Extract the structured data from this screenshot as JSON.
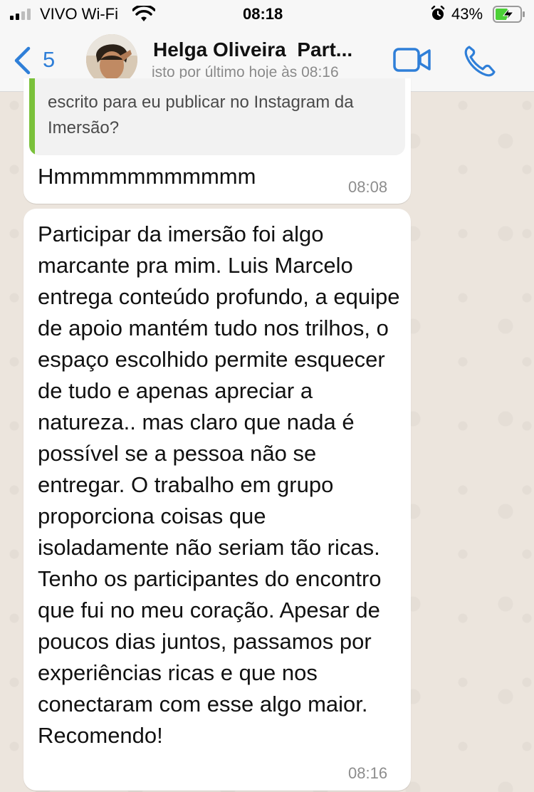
{
  "status_bar": {
    "carrier": "VIVO Wi-Fi",
    "time": "08:18",
    "battery_percent": "43%",
    "signal_bars_filled": 2,
    "signal_bars_total": 4,
    "battery_charging": true
  },
  "header": {
    "back_count": "5",
    "contact_name": "Helga Oliveira  Part...",
    "last_seen": "isto por último hoje às 08:16",
    "accent_color": "#2f7fd8"
  },
  "messages": [
    {
      "quote_text": "escrito para eu publicar no Instagram da Imersão?",
      "text": "Hmmmmmmmmmmm",
      "time": "08:08"
    },
    {
      "text": "Participar da imersão foi algo marcante pra mim. Luis Marcelo entrega conteúdo profundo, a equipe de apoio mantém tudo nos trilhos, o espaço escolhido permite esquecer de tudo e apenas apreciar a natureza.. mas claro que nada é possível se a pessoa não se entregar. O trabalho em grupo proporciona coisas que isoladamente não seriam tão ricas. Tenho os participantes do encontro que fui no meu coração. Apesar de poucos dias juntos, passamos por experiências ricas e que nos conectaram com esse algo maior. Recomendo!",
      "time": "08:16"
    }
  ],
  "colors": {
    "quote_bar": "#7ac13a",
    "bubble": "#ffffff",
    "chat_background": "#ece5dd"
  }
}
